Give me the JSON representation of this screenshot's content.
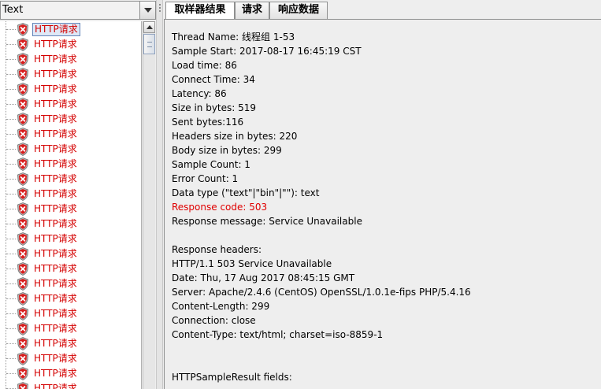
{
  "left_panel": {
    "renderer_selector": {
      "value": "Text"
    },
    "tree_items": [
      {
        "label": "HTTP请求"
      },
      {
        "label": "HTTP请求"
      },
      {
        "label": "HTTP请求"
      },
      {
        "label": "HTTP请求"
      },
      {
        "label": "HTTP请求"
      },
      {
        "label": "HTTP请求"
      },
      {
        "label": "HTTP请求"
      },
      {
        "label": "HTTP请求"
      },
      {
        "label": "HTTP请求"
      },
      {
        "label": "HTTP请求"
      },
      {
        "label": "HTTP请求"
      },
      {
        "label": "HTTP请求"
      },
      {
        "label": "HTTP请求"
      },
      {
        "label": "HTTP请求"
      },
      {
        "label": "HTTP请求"
      },
      {
        "label": "HTTP请求"
      },
      {
        "label": "HTTP请求"
      },
      {
        "label": "HTTP请求"
      },
      {
        "label": "HTTP请求"
      },
      {
        "label": "HTTP请求"
      },
      {
        "label": "HTTP请求"
      },
      {
        "label": "HTTP请求"
      },
      {
        "label": "HTTP请求"
      },
      {
        "label": "HTTP请求"
      },
      {
        "label": "HTTP请求"
      }
    ],
    "item_icon": "error-shield-icon",
    "error_color": "#d40000"
  },
  "tabs": [
    {
      "label": "取样器结果"
    },
    {
      "label": "请求"
    },
    {
      "label": "响应数据"
    }
  ],
  "sampler_result": {
    "lines": [
      {
        "text": "Thread Name: 线程组 1-53",
        "highlight": false
      },
      {
        "text": "Sample Start: 2017-08-17 16:45:19 CST",
        "highlight": false
      },
      {
        "text": "Load time: 86",
        "highlight": false
      },
      {
        "text": "Connect Time: 34",
        "highlight": false
      },
      {
        "text": "Latency: 86",
        "highlight": false
      },
      {
        "text": "Size in bytes: 519",
        "highlight": false
      },
      {
        "text": "Sent bytes:116",
        "highlight": false
      },
      {
        "text": "Headers size in bytes: 220",
        "highlight": false
      },
      {
        "text": "Body size in bytes: 299",
        "highlight": false
      },
      {
        "text": "Sample Count: 1",
        "highlight": false
      },
      {
        "text": "Error Count: 1",
        "highlight": false
      },
      {
        "text": "Data type (\"text\"|\"bin\"|\"\"): text",
        "highlight": false
      },
      {
        "text": "Response code: 503",
        "highlight": true
      },
      {
        "text": "Response message: Service Unavailable",
        "highlight": false
      },
      {
        "text": "",
        "highlight": false
      },
      {
        "text": "Response headers:",
        "highlight": false
      },
      {
        "text": "HTTP/1.1 503 Service Unavailable",
        "highlight": false
      },
      {
        "text": "Date: Thu, 17 Aug 2017 08:45:15 GMT",
        "highlight": false
      },
      {
        "text": "Server: Apache/2.4.6 (CentOS) OpenSSL/1.0.1e-fips PHP/5.4.16",
        "highlight": false
      },
      {
        "text": "Content-Length: 299",
        "highlight": false
      },
      {
        "text": "Connection: close",
        "highlight": false
      },
      {
        "text": "Content-Type: text/html; charset=iso-8859-1",
        "highlight": false
      },
      {
        "text": "",
        "highlight": false
      },
      {
        "text": "",
        "highlight": false
      },
      {
        "text": "HTTPSampleResult fields:",
        "highlight": false
      }
    ],
    "highlight_color": "#e00000"
  }
}
